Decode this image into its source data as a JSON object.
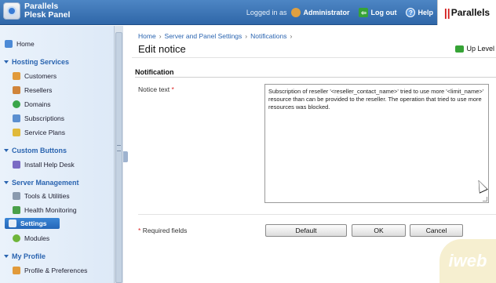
{
  "header": {
    "product_line1": "Parallels",
    "product_line2": "Plesk Panel",
    "logged_in_as": "Logged in as",
    "user": "Administrator",
    "logout": "Log out",
    "help": "Help",
    "brand_bars": "||",
    "brand_name": "Parallels"
  },
  "sidebar": {
    "home": "Home",
    "hosting_services": "Hosting Services",
    "customers": "Customers",
    "resellers": "Resellers",
    "domains": "Domains",
    "subscriptions": "Subscriptions",
    "service_plans": "Service Plans",
    "custom_buttons": "Custom Buttons",
    "install_help_desk": "Install Help Desk",
    "server_management": "Server Management",
    "tools_utilities": "Tools & Utilities",
    "health_monitoring": "Health Monitoring",
    "settings": "Settings",
    "modules": "Modules",
    "my_profile": "My Profile",
    "profile_preferences": "Profile & Preferences"
  },
  "breadcrumb": {
    "home": "Home",
    "server_settings": "Server and Panel Settings",
    "notifications": "Notifications",
    "sep": "›"
  },
  "page": {
    "title": "Edit notice",
    "up_level": "Up Level",
    "section": "Notification",
    "field_label": "Notice text",
    "required_mark": "*",
    "notice_text": "Subscription of reseller '<reseller_contact_name>' tried to use more '<limit_name>' resource than can be provided to the reseller. The operation that tried to use more resources was blocked.",
    "required_fields": "Required fields"
  },
  "buttons": {
    "default": "Default",
    "ok": "OK",
    "cancel": "Cancel"
  },
  "watermark": "iweb"
}
